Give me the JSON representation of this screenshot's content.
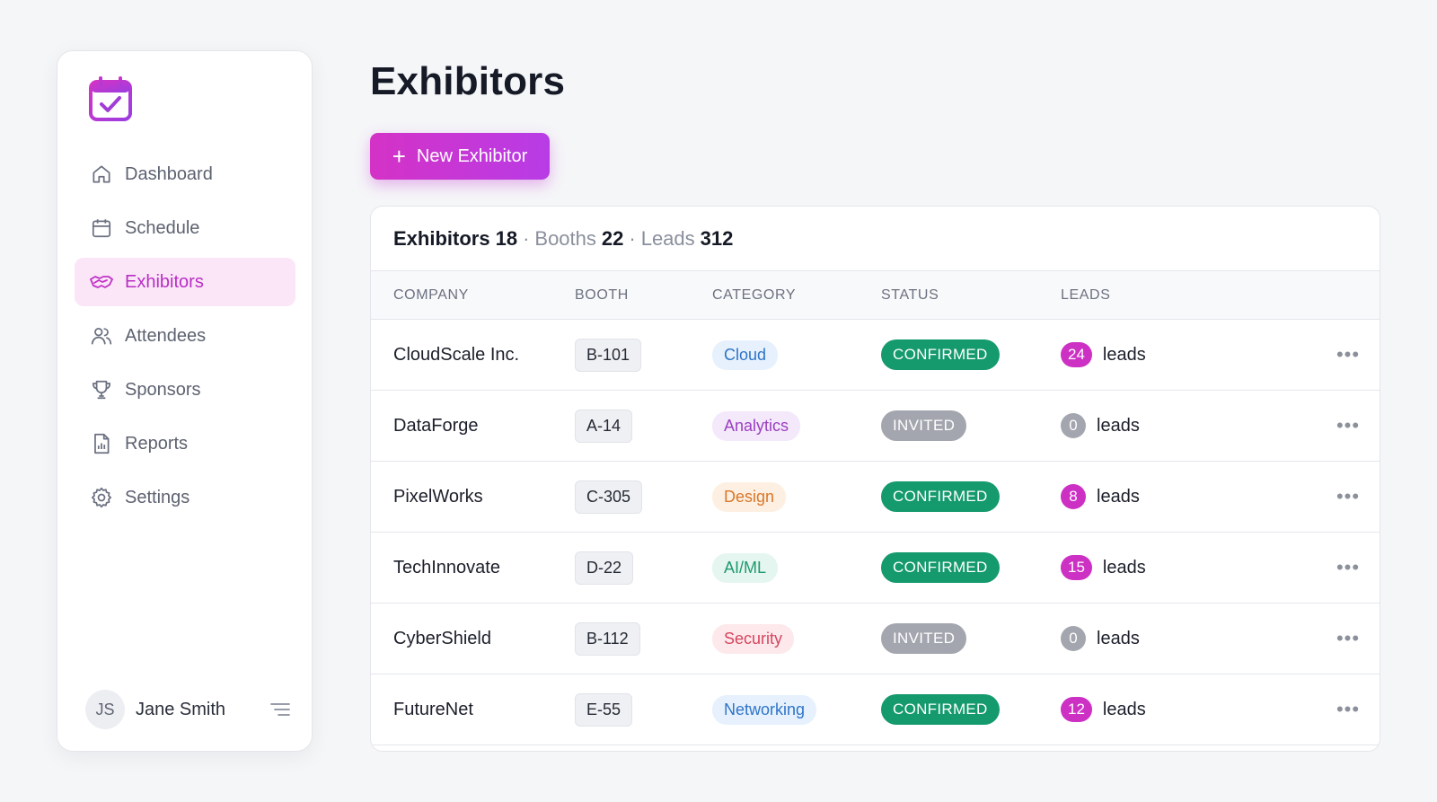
{
  "nav": [
    {
      "label": "Dashboard",
      "icon": "home-icon",
      "active": false
    },
    {
      "label": "Schedule",
      "icon": "calendar-icon",
      "active": false
    },
    {
      "label": "Exhibitors",
      "icon": "handshake-icon",
      "active": true
    },
    {
      "label": "Attendees",
      "icon": "users-icon",
      "active": false
    },
    {
      "label": "Sponsors",
      "icon": "trophy-icon",
      "active": false
    },
    {
      "label": "Reports",
      "icon": "report-icon",
      "active": false
    },
    {
      "label": "Settings",
      "icon": "gear-icon",
      "active": false
    }
  ],
  "user": {
    "initials": "JS",
    "name": "Jane Smith"
  },
  "page": {
    "title": "Exhibitors",
    "new_button_label": "New Exhibitor"
  },
  "summary": {
    "exhibitors_label": "Exhibitors",
    "exhibitors_value": "18",
    "booths_label": "Booths",
    "booths_value": "22",
    "leads_label": "Leads",
    "leads_value": "312",
    "separator": "·"
  },
  "table": {
    "headers": [
      "COMPANY",
      "BOOTH",
      "CATEGORY",
      "STATUS",
      "LEADS"
    ],
    "leads_suffix": "leads",
    "more_glyph": "•••",
    "rows": [
      {
        "company": "CloudScale Inc.",
        "booth": "B-101",
        "category": "Cloud",
        "status": "CONFIRMED",
        "leads": "24"
      },
      {
        "company": "DataForge",
        "booth": "A-14",
        "category": "Analytics",
        "status": "INVITED",
        "leads": "0"
      },
      {
        "company": "PixelWorks",
        "booth": "C-305",
        "category": "Design",
        "status": "CONFIRMED",
        "leads": "8"
      },
      {
        "company": "TechInnovate",
        "booth": "D-22",
        "category": "AI/ML",
        "status": "CONFIRMED",
        "leads": "15"
      },
      {
        "company": "CyberShield",
        "booth": "B-112",
        "category": "Security",
        "status": "INVITED",
        "leads": "0"
      },
      {
        "company": "FutureNet",
        "booth": "E-55",
        "category": "Networking",
        "status": "CONFIRMED",
        "leads": "12"
      }
    ]
  },
  "colors": {
    "accent": "#c936c8",
    "confirmed": "#149a6c",
    "invited": "#a3a6ae",
    "lead_active": "#cc31c4",
    "lead_zero": "#a3a6ae",
    "categories": {
      "Cloud": {
        "bg": "#e6f1fd",
        "fg": "#2f74c8"
      },
      "Analytics": {
        "bg": "#f4e8fb",
        "fg": "#9b3fbf"
      },
      "Design": {
        "bg": "#fdf0e2",
        "fg": "#d9772b"
      },
      "AI/ML": {
        "bg": "#e4f6ef",
        "fg": "#1f9a6e"
      },
      "Security": {
        "bg": "#fde9ec",
        "fg": "#d6455d"
      },
      "Networking": {
        "bg": "#e6f1fd",
        "fg": "#2f74c8"
      }
    }
  }
}
